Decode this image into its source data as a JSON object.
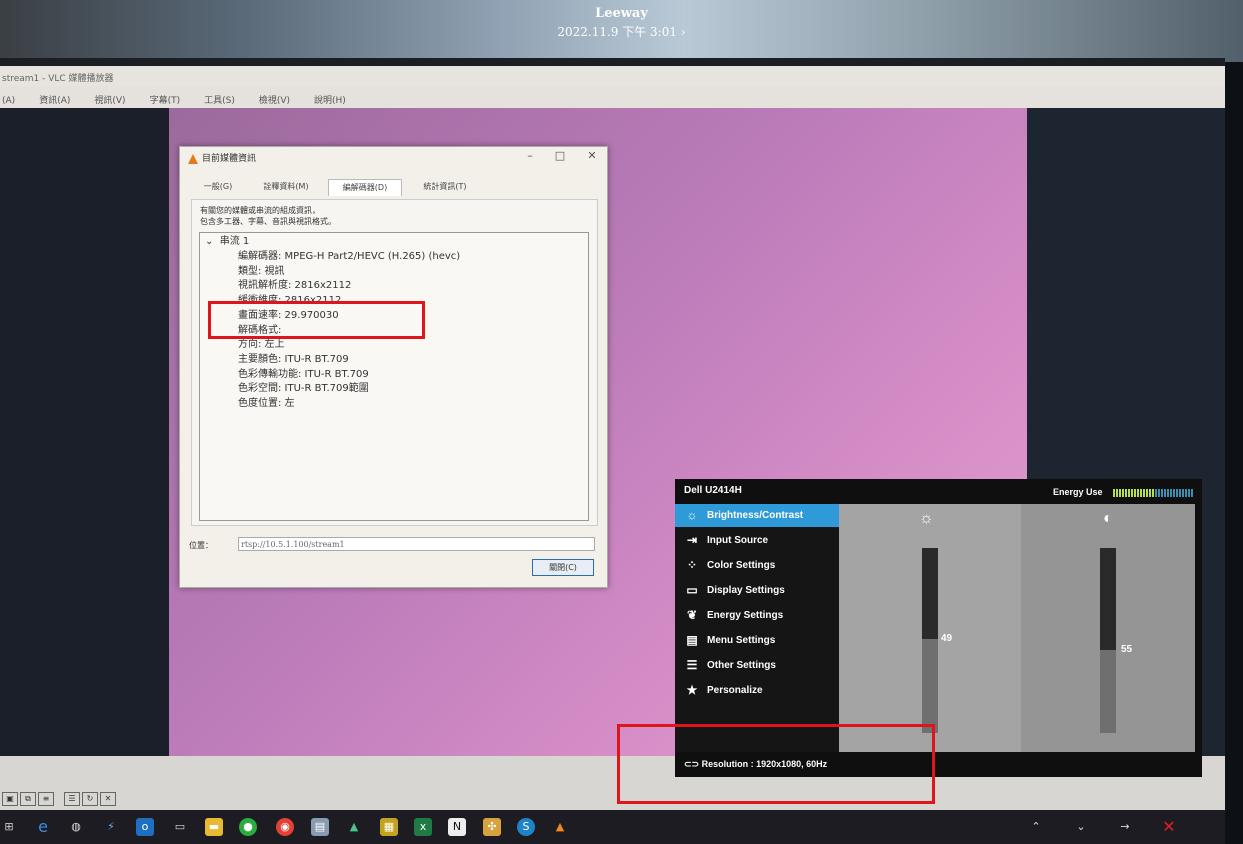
{
  "photo_header": {
    "title": "Leeway",
    "date": "2022.11.9 下午 3:01",
    "arrow": "›"
  },
  "vlc": {
    "window_title": "stream1 - VLC 媒體播放器",
    "menus": [
      "(A)",
      "資訊(A)",
      "視訊(V)",
      "字幕(T)",
      "工具(S)",
      "檢視(V)",
      "說明(H)"
    ]
  },
  "dialog": {
    "title": "目前媒體資訊",
    "tabs": [
      "一般(G)",
      "詮釋資料(M)",
      "編解碼器(D)",
      "統計資訊(T)"
    ],
    "active_tab": "編解碼器(D)",
    "description_lines": [
      "有關您的媒體或串流的組成資訊，",
      "包含多工器、字幕、音訊與視訊格式。"
    ],
    "stream_label": "串流 1",
    "codec_rows": [
      "編解碼器: MPEG-H Part2/HEVC (H.265) (hevc)",
      "類型: 視訊",
      "視訊解析度: 2816x2112",
      "緩衝維度: 2816x2112",
      "畫面速率: 29.970030",
      "解碼格式:",
      "方向: 左上",
      "主要顏色: ITU-R BT.709",
      "色彩傳輸功能: ITU-R BT.709",
      "色彩空間: ITU-R BT.709範圍",
      "色度位置: 左"
    ],
    "location_label": "位置：",
    "location_value": "rtsp://10.5.1.100/stream1",
    "close_button": "關閉(C)"
  },
  "osd": {
    "model": "Dell U2414H",
    "energy_label": "Energy Use",
    "energy_level": 0.5,
    "menu_items": [
      {
        "label": "Brightness/Contrast",
        "icon": "brightness-icon"
      },
      {
        "label": "Input Source",
        "icon": "input-source-icon"
      },
      {
        "label": "Color Settings",
        "icon": "color-settings-icon"
      },
      {
        "label": "Display Settings",
        "icon": "display-settings-icon"
      },
      {
        "label": "Energy Settings",
        "icon": "energy-settings-icon"
      },
      {
        "label": "Menu Settings",
        "icon": "menu-settings-icon"
      },
      {
        "label": "Other Settings",
        "icon": "other-settings-icon"
      },
      {
        "label": "Personalize",
        "icon": "star-icon"
      }
    ],
    "brightness_value": "49",
    "contrast_value": "55",
    "brightness_level": 0.49,
    "contrast_level": 0.55,
    "resolution_text": "Resolution : 1920x1080, 60Hz"
  },
  "colors": {
    "osd_highlight": "#2f9ad8",
    "red_box": "#e0151b",
    "energy_green": "#b8e04a",
    "energy_blue": "#3a8fb0"
  }
}
